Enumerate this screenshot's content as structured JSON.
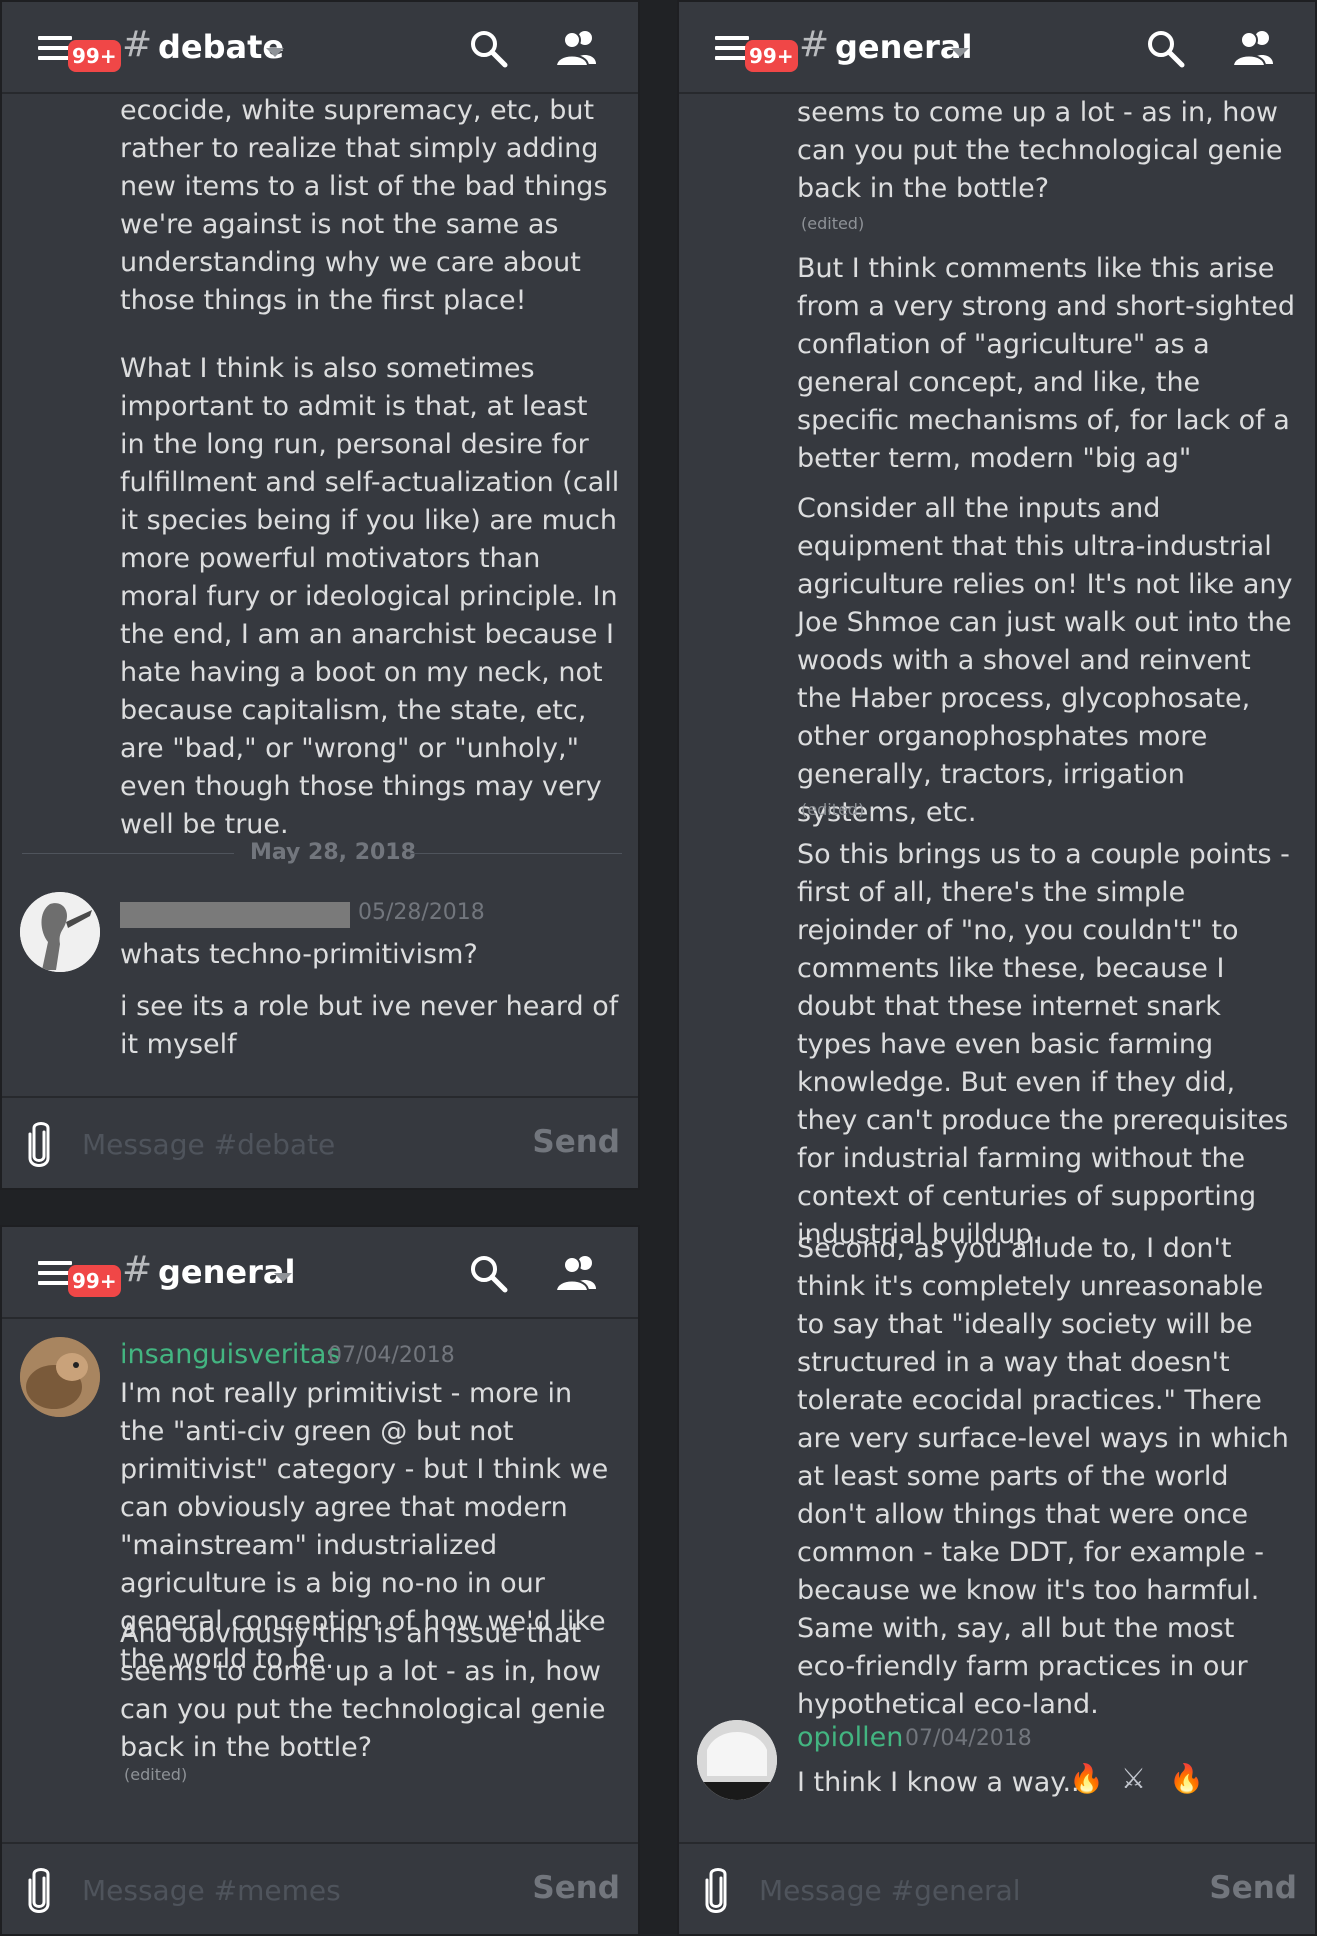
{
  "colors": {
    "accent_green": "#43b581",
    "badge_red": "#f04747",
    "background": "#36393f"
  },
  "icons": [
    "hamburger-menu-icon",
    "search-icon",
    "members-icon",
    "paperclip-icon",
    "fire-icon",
    "crossed-swords-icon"
  ],
  "panel_debate": {
    "header": {
      "badge": "99+",
      "hash": "#",
      "channel": "debate"
    },
    "messages_top": [
      "ecocide, white supremacy,  etc, but rather to realize that simply adding new items to a list of the bad things we're against is not the same as understanding why we care about those things in the first place!",
      "What I think is also sometimes important to admit is that, at least in the long run, personal desire for fulfillment and self-actualization (call it species being if you like) are much more powerful motivators than moral fury or ideological principle. In the end, I am an anarchist because I hate having a boot on my neck, not because capitalism, the state, etc, are \"bad,\" or \"wrong\" or \"unholy,\" even though those things may very well be true."
    ],
    "date_divider": "May 28, 2018",
    "user_message": {
      "timestamp": "05/28/2018",
      "lines": [
        "whats techno-primitivism?",
        "i see its a role but ive never heard of it myself"
      ]
    },
    "composer": {
      "placeholder": "Message #debate",
      "send": "Send"
    }
  },
  "panel_general_small": {
    "header": {
      "badge": "99+",
      "hash": "#",
      "channel": "general"
    },
    "message": {
      "username": "insanguisveritas",
      "timestamp": "07/04/2018",
      "paragraphs": [
        "I'm not really primitivist - more in the \"anti-civ green @ but not primitivist\" category - but I think we can obviously agree that modern \"mainstream\" industrialized agriculture is a big no-no in our general conception of how we'd like the world to be.",
        "And obviously this is an issue that seems to come up a lot - as in, how can you put the technological genie back in the bottle?"
      ],
      "edited": "(edited)"
    },
    "composer": {
      "placeholder": "Message #memes",
      "send": "Send"
    }
  },
  "panel_general_large": {
    "header": {
      "badge": "99+",
      "hash": "#",
      "channel": "general"
    },
    "paragraphs": [
      "seems to come up a lot - as in, how can you put the technological genie back in the bottle?",
      "But I think comments like this arise from a very strong and short-sighted conflation of \"agriculture\" as a general concept, and like, the specific mechanisms of, for lack of a better term, modern \"big ag\"",
      "Consider all the inputs and equipment that this ultra-industrial agriculture relies on! It's not like any Joe Shmoe can just walk out into the woods with a shovel and reinvent the Haber process, glycophosate, other organophosphates more generally, tractors, irrigation systems, etc.",
      "So this brings us to a couple points - first of all, there's the simple rejoinder of \"no, you couldn't\" to comments like these, because I doubt that these internet snark types have even basic farming knowledge. But even if they did, they can't produce the prerequisites for industrial farming without the context of centuries of supporting industrial buildup.",
      "Second, as you allude to, I don't think it's completely unreasonable to say that \"ideally society will be structured in a way that doesn't tolerate ecocidal practices.\" There are very surface-level ways in which at least some parts of the world don't allow things that were once common - take DDT, for example - because we know it's too harmful. Same with, say, all but the most eco-friendly farm practices in our hypothetical eco-land."
    ],
    "edited": "(edited)",
    "reply": {
      "username": "opiollen",
      "timestamp": "07/04/2018",
      "text": "I think I know a way...",
      "emojis": [
        "🔥",
        "⚔",
        "🔥"
      ]
    },
    "composer": {
      "placeholder": "Message #general",
      "send": "Send"
    }
  }
}
